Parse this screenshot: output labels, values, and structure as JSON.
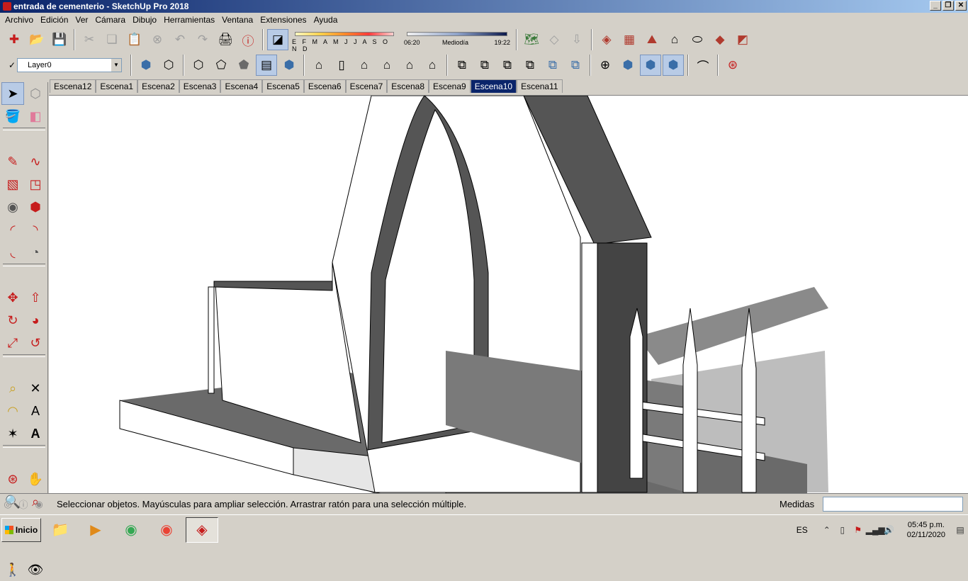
{
  "window": {
    "title": "entrada de cementerio - SketchUp Pro 2018"
  },
  "menu": [
    "Archivo",
    "Edición",
    "Ver",
    "Cámara",
    "Dibujo",
    "Herramientas",
    "Ventana",
    "Extensiones",
    "Ayuda"
  ],
  "layer": {
    "current": "Layer0"
  },
  "shadows": {
    "months_label": "E F M A M J J A S O N D",
    "time_start": "06:20",
    "time_mid": "Mediodía",
    "time_end": "19:22"
  },
  "scenes": [
    "Escena12",
    "Escena1",
    "Escena2",
    "Escena3",
    "Escena4",
    "Escena5",
    "Escena6",
    "Escena7",
    "Escena8",
    "Escena9",
    "Escena10",
    "Escena11"
  ],
  "active_scene": "Escena10",
  "status": {
    "message": "Seleccionar objetos. Mayúsculas para ampliar selección. Arrastrar ratón para una selección múltiple.",
    "measure_label": "Medidas",
    "measure_value": ""
  },
  "taskbar": {
    "start_label": "Inicio",
    "language": "ES",
    "time": "05:45 p.m.",
    "date": "02/11/2020"
  },
  "icons": [
    "sketchup-app-icon",
    "minimize-icon",
    "restore-icon",
    "close-icon",
    "new-file-icon",
    "open-folder-icon",
    "save-icon",
    "cut-icon",
    "copy-icon",
    "paste-icon",
    "erase-icon",
    "undo-icon",
    "redo-icon",
    "print-icon",
    "model-info-icon",
    "select-icon",
    "component-icon",
    "paint-bucket-icon",
    "eraser-icon",
    "pencil-icon",
    "freehand-icon",
    "rectangle-icon",
    "rotated-rectangle-icon",
    "circle-icon",
    "polygon-icon",
    "arc-icon",
    "pie-icon",
    "move-icon",
    "push-pull-icon",
    "rotate-icon",
    "follow-me-icon",
    "scale-icon",
    "offset-icon",
    "tape-measure-icon",
    "dimension-icon",
    "protractor-icon",
    "text-icon",
    "axes-icon",
    "3d-text-icon",
    "orbit-icon",
    "pan-icon",
    "zoom-icon",
    "zoom-window-icon",
    "zoom-extents-icon",
    "previous-view-icon",
    "walk-icon",
    "look-around-icon"
  ]
}
